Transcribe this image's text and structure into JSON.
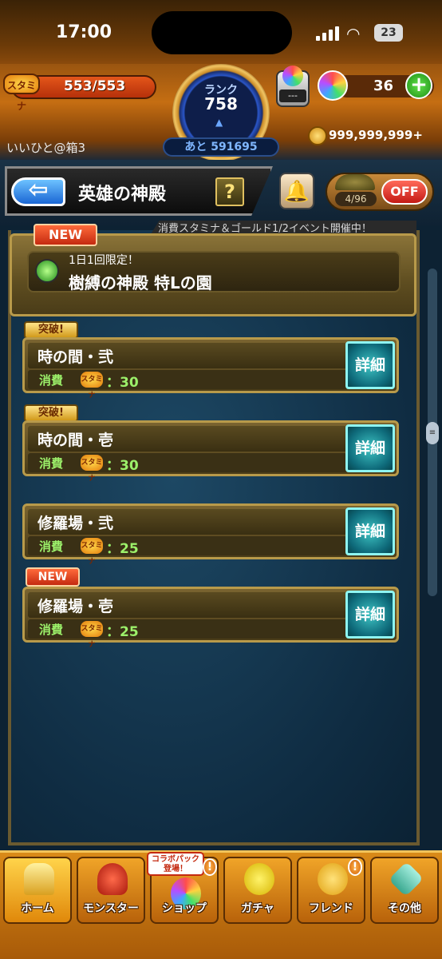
{
  "status_bar": {
    "time": "17:00",
    "battery": "23"
  },
  "hud": {
    "stamina_icon_label": "スタミナ",
    "stamina": "553/553",
    "rank_label": "ランク",
    "rank": "758",
    "next_rank": "あと 591695",
    "ticket_value": "---",
    "gems": "36",
    "gold": "999,999,999+",
    "player_name": "いいひと@箱3"
  },
  "title_bar": {
    "back_icon": "back-arrow-icon",
    "title": "英雄の神殿",
    "help_label": "?",
    "toggle_count": "4/96",
    "toggle_state": "OFF"
  },
  "event_notice": "消費スタミナ＆ゴールド1/2イベント開催中！",
  "featured": {
    "badge": "NEW",
    "note": "1日1回限定！",
    "name": "樹縛の神殿 特Lの園"
  },
  "quests": [
    {
      "badge": "突破!",
      "name": "時の間・弐",
      "cost_label": "消費",
      "cost_icon": "スタミナ",
      "cost": "：30",
      "detail": "詳細"
    },
    {
      "badge": "突破!",
      "name": "時の間・壱",
      "cost_label": "消費",
      "cost_icon": "スタミナ",
      "cost": "：30",
      "detail": "詳細"
    },
    {
      "badge": "",
      "name": "修羅場・弐",
      "cost_label": "消費",
      "cost_icon": "スタミナ",
      "cost": "：25",
      "detail": "詳細"
    },
    {
      "badge": "NEW",
      "name": "修羅場・壱",
      "cost_label": "消費",
      "cost_icon": "スタミナ",
      "cost": "：25",
      "detail": "詳細"
    }
  ],
  "nav": {
    "collab_badge": "コラボパック登場！",
    "alert": "!",
    "items": [
      {
        "label": "ホーム",
        "icon": "home-icon"
      },
      {
        "label": "モンスター",
        "icon": "monster-icon"
      },
      {
        "label": "ショップ",
        "icon": "shop-icon"
      },
      {
        "label": "ガチャ",
        "icon": "gacha-icon"
      },
      {
        "label": "フレンド",
        "icon": "friend-icon"
      },
      {
        "label": "その他",
        "icon": "other-icon"
      }
    ]
  },
  "colors": {
    "accent": "#c56e12",
    "detail_button": "#3ec4c4",
    "new_badge": "#c42a10",
    "cost_text": "#9cf06a"
  }
}
